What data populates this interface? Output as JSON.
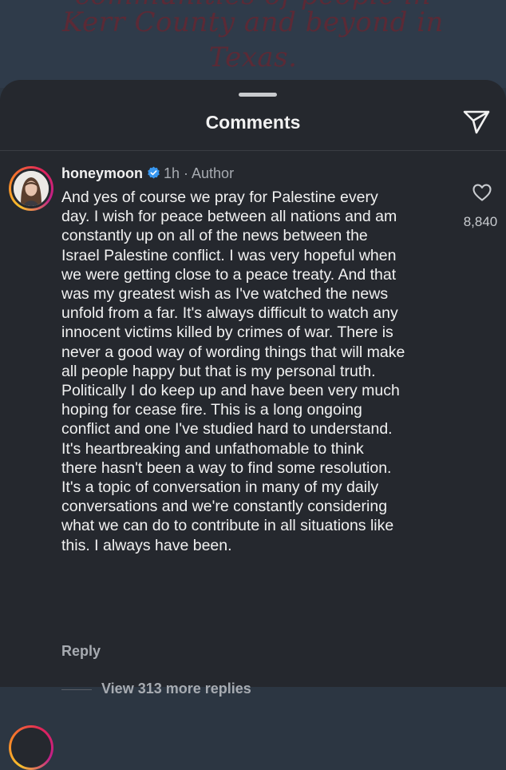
{
  "background_post": {
    "lines": [
      "communities of people in",
      "Kerr County and beyond in",
      "Texas."
    ]
  },
  "sheet": {
    "title": "Comments",
    "share_icon": "paper-plane-icon"
  },
  "comment": {
    "username": "honeymoon",
    "verified_icon": "verified-badge-icon",
    "meta": "1h · Author",
    "text_lines": [
      "And yes of course we pray for Palestine every",
      "day. I wish for peace between all nations and am",
      "constantly up on all of the news between the",
      "Israel Palestine conflict. I was very hopeful when",
      "we were getting close to a peace treaty. And that",
      "was my greatest wish as I've watched the news",
      "unfold from a far. It's always difficult to watch any",
      "innocent victims killed by crimes of war. There is",
      "never a good way of wording things that will make",
      "all people happy but that is my personal truth.",
      "Politically I do keep up and have been very much",
      "hoping for cease fire.  This is a long ongoing",
      "conflict and one I've studied hard to understand.",
      "It's heartbreaking and unfathomable to think",
      "there hasn't been a way to find some resolution.",
      "It's a topic of conversation in many of my daily",
      "conversations and we're constantly considering",
      "what we can do to contribute in all situations like",
      "this. I always have been."
    ],
    "like_icon": "heart-outline-icon",
    "like_count": "8,840",
    "reply_label": "Reply",
    "view_replies_label": "View 313 more replies"
  },
  "colors": {
    "sheet_bg": "#25282e",
    "text_primary": "#f1f1f1",
    "text_secondary": "#a7abb1",
    "verified_blue": "#3897f0"
  }
}
